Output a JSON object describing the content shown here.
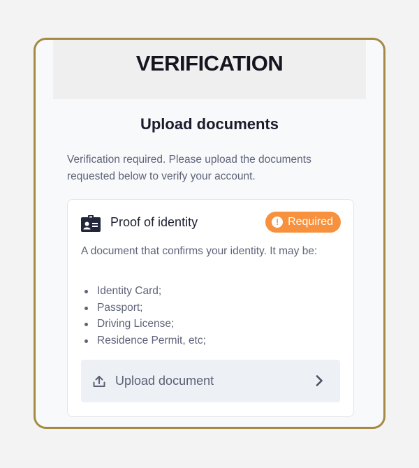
{
  "header": {
    "title": "VERIFICATION"
  },
  "section": {
    "title": "Upload documents",
    "intro": "Verification required. Please upload the documents requested below to verify your account."
  },
  "identity_card": {
    "icon": "id-card-icon",
    "title": "Proof of identity",
    "badge_label": "Required",
    "badge_icon": "info-icon",
    "description": "A document that confirms your identity. It may be:",
    "documents": [
      "Identity Card;",
      "Passport;",
      "Driving License;",
      "Residence Permit, etc;"
    ],
    "upload_label": "Upload document",
    "upload_icon": "upload-icon",
    "chevron_icon": "chevron-right-icon"
  },
  "colors": {
    "frame_border": "#a58a45",
    "badge_bg": "#f7913d",
    "title_text": "#1a1c2c",
    "body_text": "#5e6478",
    "upload_bg": "#edf0f5"
  }
}
